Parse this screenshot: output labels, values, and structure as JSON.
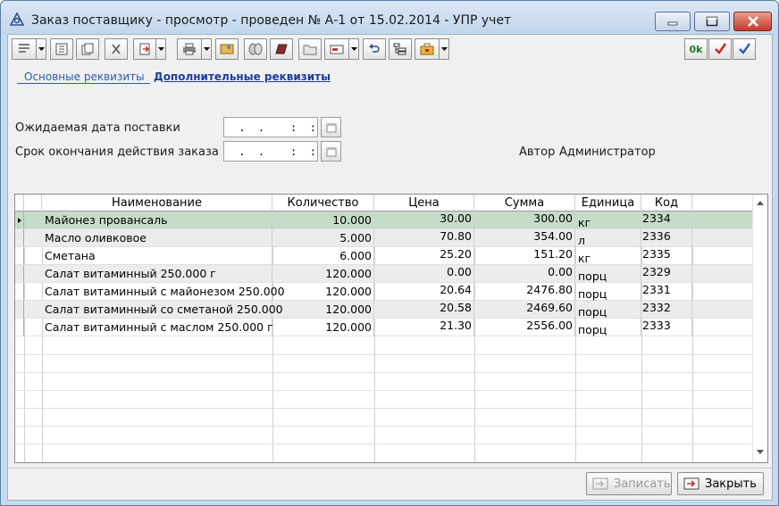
{
  "window": {
    "title": "Заказ поставщику - просмотр - проведен № А-1 от 15.02.2014 - УПР учет"
  },
  "toolbar": {
    "ok_label": "0k"
  },
  "tabs": {
    "basic": "Основные реквизиты",
    "additional": "Дополнительные реквизиты"
  },
  "form": {
    "expected_date_label": "Ожидаемая дата поставки",
    "expected_date_value": " .  .    :  :",
    "expiry_label": "Срок окончания действия заказа",
    "expiry_value": " .  .    :  :",
    "author_label": "Автор",
    "author_value": "Администратор"
  },
  "table": {
    "columns": [
      "Наименование",
      "Количество",
      "Цена",
      "Сумма",
      "Единица",
      "Код"
    ],
    "rows": [
      {
        "name": "Майонез провансаль",
        "qty": "10.000",
        "price": "30.00",
        "sum": "300.00",
        "unit": "кг",
        "code": "2334"
      },
      {
        "name": "Масло оливковое",
        "qty": "5.000",
        "price": "70.80",
        "sum": "354.00",
        "unit": "л",
        "code": "2336"
      },
      {
        "name": "Сметана",
        "qty": "6.000",
        "price": "25.20",
        "sum": "151.20",
        "unit": "кг",
        "code": "2335"
      },
      {
        "name": "Салат витаминный 250.000 г",
        "qty": "120.000",
        "price": "0.00",
        "sum": "0.00",
        "unit": "порц",
        "code": "2329"
      },
      {
        "name": "Салат витаминный с майонезом 250.000",
        "qty": "120.000",
        "price": "20.64",
        "sum": "2476.80",
        "unit": "порц",
        "code": "2331"
      },
      {
        "name": "Салат витаминный со сметаной 250.000",
        "qty": "120.000",
        "price": "20.58",
        "sum": "2469.60",
        "unit": "порц",
        "code": "2332"
      },
      {
        "name": "Салат витаминный с маслом 250.000 г",
        "qty": "120.000",
        "price": "21.30",
        "sum": "2556.00",
        "unit": "порц",
        "code": "2333"
      }
    ]
  },
  "buttons": {
    "save": "Записать",
    "close": "Закрыть"
  },
  "colors": {
    "selected_row": "#c5dcc9",
    "alt_row": "#ececec",
    "link": "#2f5da8"
  }
}
